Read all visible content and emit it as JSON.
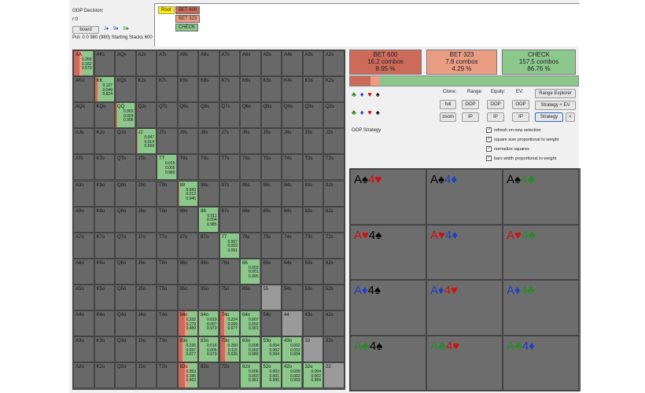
{
  "header": {
    "decision": "OOP Decision:",
    "board_text": "r:0",
    "board_button": "board",
    "board_cards": [
      {
        "t": "J♦",
        "c": "#1f3fbf"
      },
      {
        "t": "9♦",
        "c": "#1f3fbf"
      },
      {
        "t": "8♣",
        "c": "#2a8a2a"
      }
    ],
    "pot": "Pot: 0 0 980 (980) Starting Stacks 600"
  },
  "tree": {
    "root": "Root",
    "nodes": [
      {
        "label": "BET 600",
        "color": "#cd6b5a"
      },
      {
        "label": "BET 323",
        "color": "#e99d83"
      },
      {
        "label": "CHECK",
        "color": "#8cc88c"
      }
    ]
  },
  "actions": [
    {
      "name": "BET 600",
      "combos": "16.2 combos",
      "pct": "8.95 %",
      "color": "#cd6b5a"
    },
    {
      "name": "BET 323",
      "combos": "7.8 combos",
      "pct": "4.29 %",
      "color": "#e99d83"
    },
    {
      "name": "CHECK",
      "combos": "157.5 combos",
      "pct": "86.76 %",
      "color": "#8cc88c"
    }
  ],
  "strategy_ratio": [
    0.0895,
    0.0429,
    0.8676
  ],
  "suit_row1": [
    {
      "t": "♣",
      "c": "#2a8a2a"
    },
    {
      "t": "♦",
      "c": "#1f3fbf"
    },
    {
      "t": "♥",
      "c": "#d01010"
    },
    {
      "t": "♠",
      "c": "#000"
    }
  ],
  "suit_row2": [
    {
      "t": "♣",
      "c": "#2a8a2a"
    },
    {
      "t": "♦",
      "c": "#1f3fbf"
    },
    {
      "t": "♥",
      "c": "#d01010"
    },
    {
      "t": "♠",
      "c": "#000"
    }
  ],
  "labels": {
    "clone": "Clone:",
    "range": "Range:",
    "equity": "Equity:",
    "ev": "EV:",
    "oop_strategy": "OOP Strategy"
  },
  "buttons": {
    "full": "full",
    "zoom": "zoom",
    "range_oop": "OOP",
    "range_ip": "IP",
    "eq_oop": "OOP",
    "eq_ip": "IP",
    "ev_oop": "OOP",
    "ev_ip": "IP",
    "range_explorer": "Range Explorer",
    "strategy_ev": "Strategy + EV",
    "strategy": "Strategy",
    "back": "<"
  },
  "checkboxes": [
    {
      "label": "refresh on new selection",
      "checked": true
    },
    {
      "label": "square size proportional to weight",
      "checked": true
    },
    {
      "label": "normalize squares",
      "checked": true
    },
    {
      "label": "bars width proportional to weight",
      "checked": true
    }
  ],
  "grid": {
    "rows": [
      [
        "AA",
        "AKs",
        "AQs",
        "AJs",
        "ATs",
        "A9s",
        "A8s",
        "A7s",
        "A6s",
        "A5s",
        "A4s",
        "A3s",
        "A2s"
      ],
      [
        "AKo",
        "KK",
        "KQs",
        "KJs",
        "KTs",
        "K9s",
        "K8s",
        "K7s",
        "K6s",
        "K5s",
        "K4s",
        "K3s",
        "K2s"
      ],
      [
        "AQo",
        "KQo",
        "QQ",
        "QJs",
        "QTs",
        "Q9s",
        "Q8s",
        "Q7s",
        "Q6s",
        "Q5s",
        "Q4s",
        "Q3s",
        "Q2s"
      ],
      [
        "AJo",
        "KJo",
        "QJo",
        "JJ",
        "JTs",
        "J9s",
        "J8s",
        "J7s",
        "J6s",
        "J5s",
        "J4s",
        "J3s",
        "J2s"
      ],
      [
        "ATo",
        "KTo",
        "QTo",
        "JTo",
        "TT",
        "T9s",
        "T8s",
        "T7s",
        "T6s",
        "T5s",
        "T4s",
        "T3s",
        "T2s"
      ],
      [
        "A9o",
        "K9o",
        "Q9o",
        "J9o",
        "T9o",
        "99",
        "98s",
        "97s",
        "96s",
        "95s",
        "94s",
        "93s",
        "92s"
      ],
      [
        "A8o",
        "K8o",
        "Q8o",
        "J8o",
        "T8o",
        "98o",
        "88",
        "87s",
        "86s",
        "85s",
        "84s",
        "83s",
        "82s"
      ],
      [
        "A7o",
        "K7o",
        "Q7o",
        "J7o",
        "T7o",
        "97o",
        "87o",
        "77",
        "76s",
        "75s",
        "74s",
        "73s",
        "72s"
      ],
      [
        "A6o",
        "K6o",
        "Q6o",
        "J6o",
        "T6o",
        "96o",
        "86o",
        "76o",
        "66",
        "65s",
        "64s",
        "63s",
        "62s"
      ],
      [
        "A5o",
        "K5o",
        "Q5o",
        "J5o",
        "T5o",
        "95o",
        "85o",
        "75o",
        "65o",
        "55",
        "54s",
        "53s",
        "52s"
      ],
      [
        "A4o",
        "K4o",
        "Q4o",
        "J4o",
        "T4o",
        "94o",
        "84o",
        "74o",
        "64o",
        "54o",
        "44",
        "43s",
        "42s"
      ],
      [
        "A3o",
        "K3o",
        "Q3o",
        "J3o",
        "T3o",
        "93o",
        "83o",
        "73o",
        "63o",
        "53o",
        "43o",
        "33",
        "32s"
      ],
      [
        "A2o",
        "K2o",
        "Q2o",
        "J2o",
        "T2o",
        "92o",
        "82o",
        "72o",
        "62o",
        "52o",
        "42o",
        "32o",
        "22"
      ]
    ],
    "strategies": [
      {
        "r": 0,
        "c": 0,
        "vals": [
          "0.268",
          "0.162",
          "0.570"
        ]
      },
      {
        "r": 1,
        "c": 1,
        "vals": [
          "0.127",
          "0.049",
          "0.824"
        ]
      },
      {
        "r": 2,
        "c": 2,
        "vals": [
          "0.063",
          "0.029",
          "0.908"
        ]
      },
      {
        "r": 3,
        "c": 3,
        "vals": [
          "0.047",
          "0.014",
          "0.939"
        ]
      },
      {
        "r": 4,
        "c": 4,
        "vals": [
          "0.015",
          "0.005",
          "0.980"
        ]
      },
      {
        "r": 5,
        "c": 5,
        "vals": [
          "0.043",
          "0.012",
          "0.945"
        ]
      },
      {
        "r": 6,
        "c": 6,
        "vals": [
          "0.011",
          "0.004",
          "0.985"
        ]
      },
      {
        "r": 7,
        "c": 7,
        "vals": [
          "0.007",
          "0.002",
          "0.991"
        ]
      },
      {
        "r": 8,
        "c": 8,
        "vals": [
          "0.003",
          "0.001",
          "0.995"
        ]
      },
      {
        "r": 10,
        "c": 5,
        "vals": [
          "0.332",
          "0.179",
          "0.489"
        ]
      },
      {
        "r": 10,
        "c": 6,
        "vals": [
          "0.019",
          "0.007",
          "0.973"
        ]
      },
      {
        "r": 10,
        "c": 7,
        "vals": [
          "0.224",
          "0.099",
          "0.677"
        ]
      },
      {
        "r": 10,
        "c": 8,
        "vals": [
          "0.007",
          "0.002",
          "0.991"
        ]
      },
      {
        "r": 11,
        "c": 5,
        "vals": [
          "0.226",
          "0.097",
          "0.677"
        ]
      },
      {
        "r": 11,
        "c": 6,
        "vals": [
          "0.016",
          "0.005",
          "0.979"
        ]
      },
      {
        "r": 11,
        "c": 7,
        "vals": [
          "0.250",
          "0.115",
          "0.635"
        ]
      },
      {
        "r": 11,
        "c": 8,
        "vals": [
          "0.008",
          "0.003",
          "0.989"
        ]
      },
      {
        "r": 11,
        "c": 9,
        "vals": [
          "0.004",
          "0.002",
          "0.994"
        ]
      },
      {
        "r": 11,
        "c": 10,
        "vals": [
          "0.002",
          "0.002",
          "0.994"
        ]
      },
      {
        "r": 12,
        "c": 5,
        "vals": [
          "0.353",
          "0.185",
          "0.463"
        ]
      },
      {
        "r": 12,
        "c": 8,
        "vals": [
          "0.006",
          "0.003",
          "0.991"
        ]
      },
      {
        "r": 12,
        "c": 9,
        "vals": [
          "0.003",
          "0.001",
          "0.995"
        ]
      },
      {
        "r": 12,
        "c": 10,
        "vals": [
          "0.005",
          "0.002",
          "0.993"
        ]
      },
      {
        "r": 12,
        "c": 11,
        "vals": [
          "0.004",
          "0.002",
          "0.994"
        ]
      }
    ],
    "light_cells": [
      {
        "r": 9,
        "c": 9
      },
      {
        "r": 10,
        "c": 10
      },
      {
        "r": 11,
        "c": 11
      },
      {
        "r": 12,
        "c": 12
      }
    ]
  },
  "combos": [
    [
      {
        "t": "A",
        "c": "#000"
      },
      {
        "t": "♠",
        "c": "#000"
      },
      {
        "t": "4",
        "c": "#d01010"
      },
      {
        "t": "♥",
        "c": "#d01010"
      }
    ],
    [
      {
        "t": "A",
        "c": "#000"
      },
      {
        "t": "♠",
        "c": "#000"
      },
      {
        "t": "4",
        "c": "#1f3fbf"
      },
      {
        "t": "♦",
        "c": "#1f3fbf"
      }
    ],
    [
      {
        "t": "A",
        "c": "#000"
      },
      {
        "t": "♠",
        "c": "#000"
      },
      {
        "t": "4",
        "c": "#2a8a2a"
      },
      {
        "t": "♣",
        "c": "#2a8a2a"
      }
    ],
    [
      {
        "t": "A",
        "c": "#d01010"
      },
      {
        "t": "♥",
        "c": "#d01010"
      },
      {
        "t": "4",
        "c": "#000"
      },
      {
        "t": "♠",
        "c": "#000"
      }
    ],
    [
      {
        "t": "A",
        "c": "#d01010"
      },
      {
        "t": "♥",
        "c": "#d01010"
      },
      {
        "t": "4",
        "c": "#1f3fbf"
      },
      {
        "t": "♦",
        "c": "#1f3fbf"
      }
    ],
    [
      {
        "t": "A",
        "c": "#d01010"
      },
      {
        "t": "♥",
        "c": "#d01010"
      },
      {
        "t": "4",
        "c": "#2a8a2a"
      },
      {
        "t": "♣",
        "c": "#2a8a2a"
      }
    ],
    [
      {
        "t": "A",
        "c": "#1f3fbf"
      },
      {
        "t": "♦",
        "c": "#1f3fbf"
      },
      {
        "t": "4",
        "c": "#000"
      },
      {
        "t": "♠",
        "c": "#000"
      }
    ],
    [
      {
        "t": "A",
        "c": "#1f3fbf"
      },
      {
        "t": "♦",
        "c": "#1f3fbf"
      },
      {
        "t": "4",
        "c": "#d01010"
      },
      {
        "t": "♥",
        "c": "#d01010"
      }
    ],
    [
      {
        "t": "A",
        "c": "#1f3fbf"
      },
      {
        "t": "♦",
        "c": "#1f3fbf"
      },
      {
        "t": "4",
        "c": "#2a8a2a"
      },
      {
        "t": "♣",
        "c": "#2a8a2a"
      }
    ],
    [
      {
        "t": "A",
        "c": "#2a8a2a"
      },
      {
        "t": "♣",
        "c": "#2a8a2a"
      },
      {
        "t": "4",
        "c": "#000"
      },
      {
        "t": "♠",
        "c": "#000"
      }
    ],
    [
      {
        "t": "A",
        "c": "#2a8a2a"
      },
      {
        "t": "♣",
        "c": "#2a8a2a"
      },
      {
        "t": "4",
        "c": "#d01010"
      },
      {
        "t": "♥",
        "c": "#d01010"
      }
    ],
    [
      {
        "t": "A",
        "c": "#2a8a2a"
      },
      {
        "t": "♣",
        "c": "#2a8a2a"
      },
      {
        "t": "4",
        "c": "#1f3fbf"
      },
      {
        "t": "♦",
        "c": "#1f3fbf"
      }
    ]
  ],
  "colors": {
    "bet_big": "#cd6b5a",
    "bet_small": "#e99d83",
    "check": "#8cc88c",
    "cell_bg": "#686868",
    "cell_light": "#9a9a9a"
  }
}
